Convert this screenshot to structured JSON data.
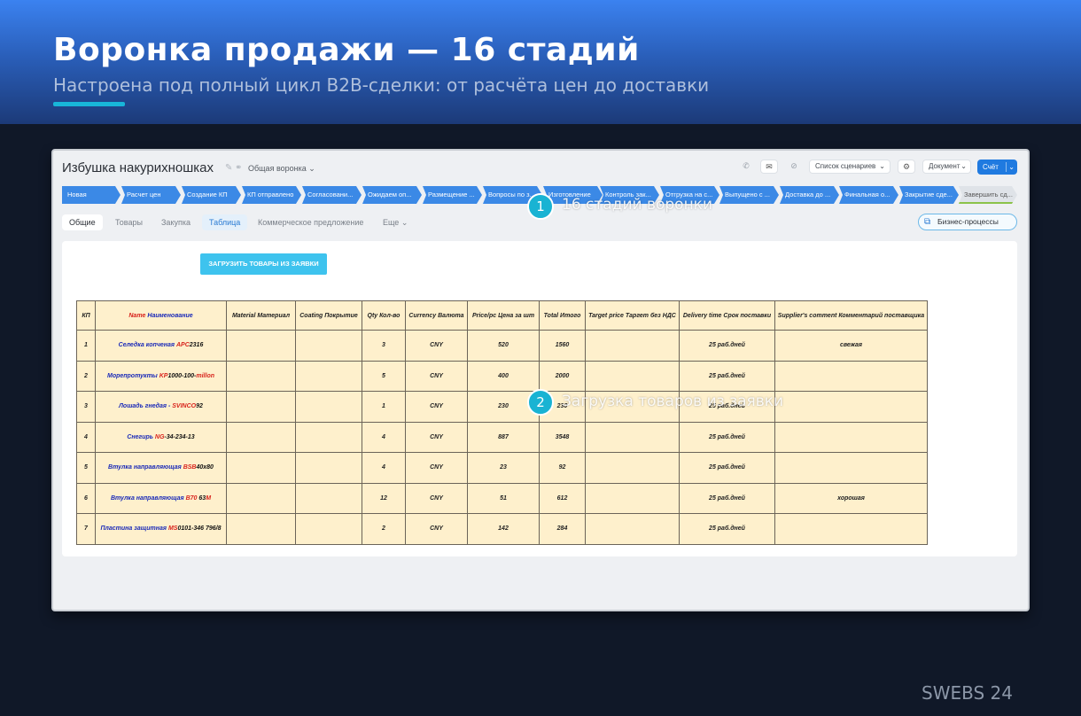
{
  "slide": {
    "title": "Воронка продажи — 16 стадий",
    "subtitle": "Настроена под полный цикл B2B-сделки: от расчёта цен до доставки",
    "accent_color": "#18b6d9"
  },
  "app": {
    "deal_name": "Избушка накурихношках",
    "funnel_select": "Общая воронка ⌄",
    "scenarios_select": "Список сценариев",
    "document_select": "Документ",
    "invoice_button": "Счёт",
    "icons": [
      "phone-icon",
      "mail-icon",
      "block-icon",
      "settings-icon",
      "pencil-icon",
      "link-icon"
    ]
  },
  "stages": [
    "Новая",
    "Расчет цен",
    "Создание КП",
    "КП отправлено",
    "Согласовани...",
    "Ожидаем оп...",
    "Размещение ...",
    "Вопросы по з...",
    "Изготовление",
    "Контроль зак...",
    "Отгрузка на с...",
    "Выпущено с ...",
    "Доставка до ...",
    "Финальная о...",
    "Закрытие сде...",
    "Завершить сд..."
  ],
  "tabs": [
    "Общие",
    "Товары",
    "Закупка",
    "Таблица",
    "Коммерческое предложение",
    "Еще ⌄"
  ],
  "business_processes_button": "Бизнес-процессы",
  "load_button": "ЗАГРУЗИТЬ ТОВАРЫ ИЗ ЗАЯВКИ",
  "table": {
    "headers": {
      "kp": "КП",
      "name_en": "Name",
      "name_ru": " Наименование",
      "material": "Material Материал",
      "coating": "Coating Покрытие",
      "qty": "Qty Кол-во",
      "currency": "Currency Валюта",
      "price": "Price/pc Цена за шт",
      "total": "Total Итого",
      "target": "Target price Таргет без НДС",
      "delivery": "Delivery time Срок поставки",
      "comment": "Supplier's comment Комментарий поставщика"
    },
    "rows": [
      {
        "kp": "1",
        "name_a": "Селедка копченая ",
        "name_b": "APC",
        "name_c": "2316",
        "name_d": "",
        "qty": "3",
        "currency": "CNY",
        "price": "520",
        "total": "1560",
        "delivery": "25 раб.дней",
        "comment": "свежая"
      },
      {
        "kp": "2",
        "name_a": "Морепротукты ",
        "name_b": "KP",
        "name_c": "1000-100-",
        "name_d": "millon",
        "qty": "5",
        "currency": "CNY",
        "price": "400",
        "total": "2000",
        "delivery": "25 раб.дней",
        "comment": ""
      },
      {
        "kp": "3",
        "name_a": "Лошадь гнедая - ",
        "name_b": "SVINCO",
        "name_c": "92",
        "name_d": "",
        "qty": "1",
        "currency": "CNY",
        "price": "230",
        "total": "230",
        "delivery": "25 раб.дней",
        "comment": ""
      },
      {
        "kp": "4",
        "name_a": "Снегирь ",
        "name_b": "NG",
        "name_c": "-34-234-13",
        "name_d": "",
        "qty": "4",
        "currency": "CNY",
        "price": "887",
        "total": "3548",
        "delivery": "25 раб.дней",
        "comment": ""
      },
      {
        "kp": "5",
        "name_a": "Втулка направляющая ",
        "name_b": "BSB",
        "name_c": "40x80",
        "name_d": "",
        "qty": "4",
        "currency": "CNY",
        "price": "23",
        "total": "92",
        "delivery": "25 раб.дней",
        "comment": ""
      },
      {
        "kp": "6",
        "name_a": "Втулка направляющая ",
        "name_b": "B70",
        "name_c": " 63",
        "name_d": "M",
        "qty": "12",
        "currency": "CNY",
        "price": "51",
        "total": "612",
        "delivery": "25 раб.дней",
        "comment": "хорошая"
      },
      {
        "kp": "7",
        "name_a": "Пластина защитная ",
        "name_b": "MS",
        "name_c": "0101-346 796/8",
        "name_d": "",
        "qty": "2",
        "currency": "CNY",
        "price": "142",
        "total": "284",
        "delivery": "25 раб.дней",
        "comment": ""
      }
    ]
  },
  "callouts": [
    {
      "number": "1",
      "text": "16 стадий воронки"
    },
    {
      "number": "2",
      "text": "Загрузка товаров из заявки"
    }
  ],
  "footer_mark": "SWEBS 24"
}
